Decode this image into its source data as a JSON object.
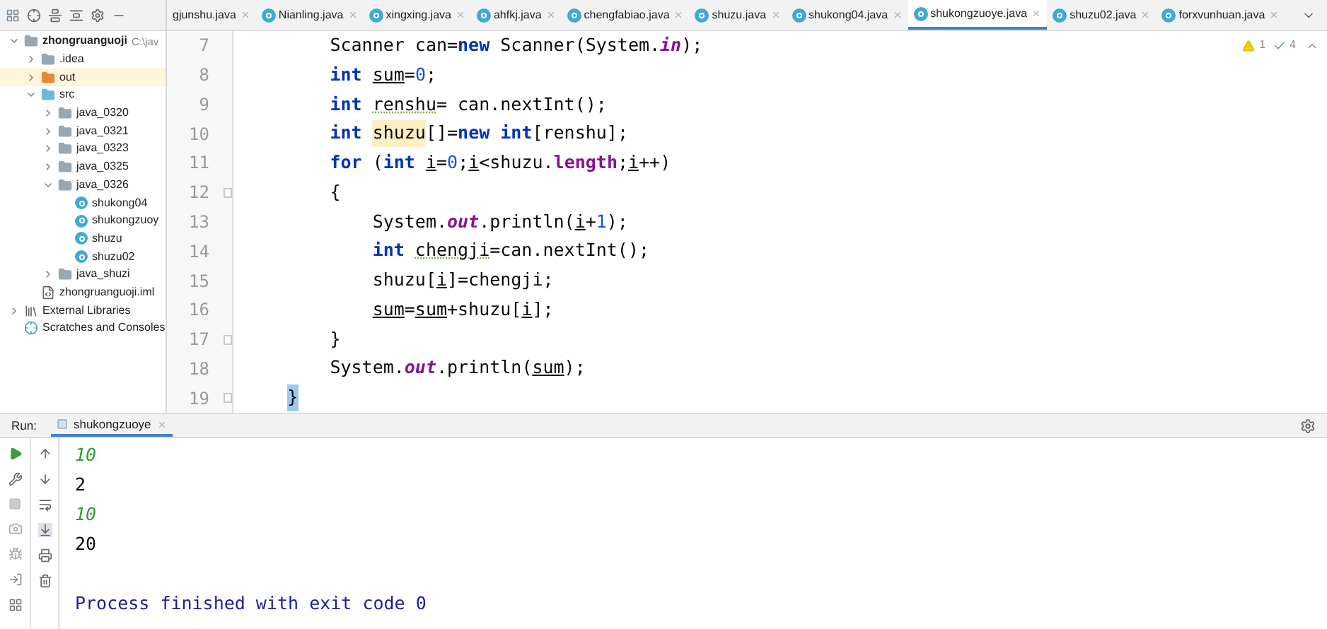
{
  "editor_tabs": [
    {
      "label": "gjunshu.java",
      "icon": false,
      "selected": false
    },
    {
      "label": "Nianling.java",
      "icon": true,
      "selected": false
    },
    {
      "label": "xingxing.java",
      "icon": true,
      "selected": false
    },
    {
      "label": "ahfkj.java",
      "icon": true,
      "selected": false
    },
    {
      "label": "chengfabiao.java",
      "icon": true,
      "selected": false
    },
    {
      "label": "shuzu.java",
      "icon": true,
      "selected": false
    },
    {
      "label": "shukong04.java",
      "icon": true,
      "selected": false
    },
    {
      "label": "shukongzuoye.java",
      "icon": true,
      "selected": true
    },
    {
      "label": "shuzu02.java",
      "icon": true,
      "selected": false
    },
    {
      "label": "forxvunhuan.java",
      "icon": true,
      "selected": false
    }
  ],
  "project_tree": [
    {
      "label": "zhongruanguoji",
      "path": "C:\\jav",
      "kind": "project",
      "expanded": true,
      "selected": false,
      "children": [
        {
          "label": ".idea",
          "kind": "folder",
          "expanded": false,
          "selected": false
        },
        {
          "label": "out",
          "kind": "excluded",
          "expanded": false,
          "selected": true
        },
        {
          "label": "src",
          "kind": "source",
          "expanded": true,
          "selected": false,
          "children": [
            {
              "label": "java_0320",
              "kind": "package",
              "expanded": false,
              "selected": false
            },
            {
              "label": "java_0321",
              "kind": "package",
              "expanded": false,
              "selected": false
            },
            {
              "label": "java_0323",
              "kind": "package",
              "expanded": false,
              "selected": false
            },
            {
              "label": "java_0325",
              "kind": "package",
              "expanded": false,
              "selected": false
            },
            {
              "label": "java_0326",
              "kind": "package",
              "expanded": true,
              "selected": false,
              "children": [
                {
                  "label": "shukong04",
                  "kind": "class",
                  "selected": false
                },
                {
                  "label": "shukongzuoy",
                  "kind": "class",
                  "selected": false
                },
                {
                  "label": "shuzu",
                  "kind": "class",
                  "selected": false
                },
                {
                  "label": "shuzu02",
                  "kind": "class",
                  "selected": false
                }
              ]
            },
            {
              "label": "java_shuzi",
              "kind": "package",
              "expanded": false,
              "selected": false
            }
          ]
        },
        {
          "label": "zhongruanguoji.iml",
          "kind": "file",
          "selected": false
        }
      ]
    },
    {
      "label": "External Libraries",
      "kind": "library",
      "expanded": false,
      "selected": false
    },
    {
      "label": "Scratches and Consoles",
      "kind": "scratches",
      "selected": false
    }
  ],
  "inspections": {
    "warnings": "1",
    "typos": "4"
  },
  "code_lines": [
    {
      "number": "7",
      "fold": false,
      "tokens": [
        {
          "text": "        Scanner can=",
          "kind": "plain"
        },
        {
          "text": "new",
          "kind": "keyword"
        },
        {
          "text": " Scanner(System.",
          "kind": "plain"
        },
        {
          "text": "in",
          "kind": "static"
        },
        {
          "text": ");",
          "kind": "plain"
        }
      ]
    },
    {
      "number": "8",
      "fold": false,
      "tokens": [
        {
          "text": "        int ",
          "kind": "keyword"
        },
        {
          "text": "sum",
          "kind": "var"
        },
        {
          "text": "=",
          "kind": "plain"
        },
        {
          "text": "0",
          "kind": "number"
        },
        {
          "text": ";",
          "kind": "plain"
        }
      ]
    },
    {
      "number": "9",
      "fold": false,
      "tokens": [
        {
          "text": "        int ",
          "kind": "keyword"
        },
        {
          "text": "renshu",
          "kind": "typo"
        },
        {
          "text": "= can.nextInt();",
          "kind": "plain"
        }
      ]
    },
    {
      "number": "10",
      "fold": false,
      "tokens": [
        {
          "text": "        int ",
          "kind": "keyword"
        },
        {
          "text": "shuzu",
          "kind": "highlight"
        },
        {
          "text": "[]=",
          "kind": "plain"
        },
        {
          "text": "new int",
          "kind": "keyword"
        },
        {
          "text": "[renshu];",
          "kind": "plain"
        }
      ]
    },
    {
      "number": "11",
      "fold": false,
      "tokens": [
        {
          "text": "        for",
          "kind": "keyword"
        },
        {
          "text": " (",
          "kind": "plain"
        },
        {
          "text": "int ",
          "kind": "keyword"
        },
        {
          "text": "i",
          "kind": "var"
        },
        {
          "text": "=",
          "kind": "plain"
        },
        {
          "text": "0",
          "kind": "number"
        },
        {
          "text": ";",
          "kind": "plain"
        },
        {
          "text": "i",
          "kind": "var"
        },
        {
          "text": "<shuzu.",
          "kind": "plain"
        },
        {
          "text": "length",
          "kind": "field"
        },
        {
          "text": ";",
          "kind": "plain"
        },
        {
          "text": "i",
          "kind": "var"
        },
        {
          "text": "++)",
          "kind": "plain"
        }
      ]
    },
    {
      "number": "12",
      "fold": true,
      "tokens": [
        {
          "text": "        {",
          "kind": "plain"
        }
      ]
    },
    {
      "number": "13",
      "fold": false,
      "tokens": [
        {
          "text": "            System.",
          "kind": "plain"
        },
        {
          "text": "out",
          "kind": "static"
        },
        {
          "text": ".println(",
          "kind": "plain"
        },
        {
          "text": "i",
          "kind": "var"
        },
        {
          "text": "+",
          "kind": "plain"
        },
        {
          "text": "1",
          "kind": "number"
        },
        {
          "text": ");",
          "kind": "plain"
        }
      ]
    },
    {
      "number": "14",
      "fold": false,
      "tokens": [
        {
          "text": "            int ",
          "kind": "keyword"
        },
        {
          "text": "chengji",
          "kind": "typo"
        },
        {
          "text": "=can.nextInt();",
          "kind": "plain"
        }
      ]
    },
    {
      "number": "15",
      "fold": false,
      "tokens": [
        {
          "text": "            shuzu[",
          "kind": "plain"
        },
        {
          "text": "i",
          "kind": "var"
        },
        {
          "text": "]=chengji;",
          "kind": "plain"
        }
      ]
    },
    {
      "number": "16",
      "fold": false,
      "tokens": [
        {
          "text": "            sum",
          "kind": "var"
        },
        {
          "text": "=",
          "kind": "plain"
        },
        {
          "text": "sum",
          "kind": "var"
        },
        {
          "text": "+shuzu[",
          "kind": "plain"
        },
        {
          "text": "i",
          "kind": "var"
        },
        {
          "text": "];",
          "kind": "plain"
        }
      ]
    },
    {
      "number": "17",
      "fold": true,
      "tokens": [
        {
          "text": "        }",
          "kind": "plain"
        }
      ]
    },
    {
      "number": "18",
      "fold": false,
      "tokens": [
        {
          "text": "        System.",
          "kind": "plain"
        },
        {
          "text": "out",
          "kind": "static"
        },
        {
          "text": ".println(",
          "kind": "plain"
        },
        {
          "text": "sum",
          "kind": "var"
        },
        {
          "text": ");",
          "kind": "plain"
        }
      ]
    },
    {
      "number": "19",
      "fold": true,
      "tokens": [
        {
          "text": "    }",
          "kind": "matched"
        }
      ]
    }
  ],
  "run_panel": {
    "label": "Run:",
    "tab": "shukongzuoye",
    "console": [
      {
        "text": "10",
        "kind": "input"
      },
      {
        "text": "2",
        "kind": "output"
      },
      {
        "text": "10",
        "kind": "input"
      },
      {
        "text": "20",
        "kind": "output"
      },
      {
        "text": "Process finished with exit code 0",
        "kind": "exit"
      }
    ]
  }
}
